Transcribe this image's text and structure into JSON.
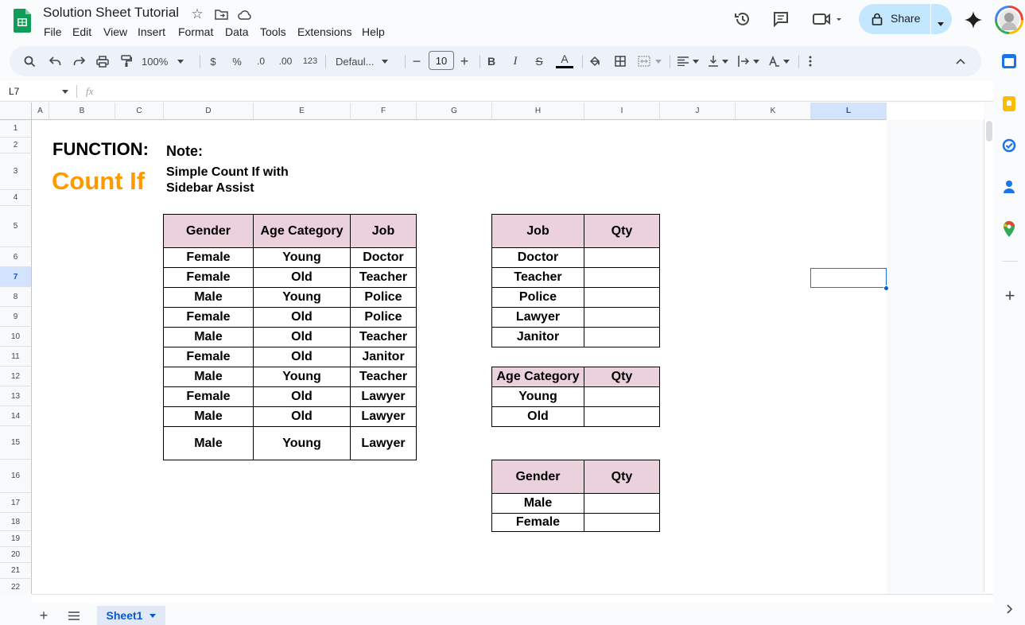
{
  "app": {
    "title": "Solution Sheet Tutorial",
    "menu": [
      "File",
      "Edit",
      "View",
      "Insert",
      "Format",
      "Data",
      "Tools",
      "Extensions",
      "Help"
    ],
    "share_label": "Share"
  },
  "toolbar": {
    "zoom": "100%",
    "currency": "$",
    "percent": "%",
    "dec_decrease": ".0",
    "dec_increase": ".00",
    "number_format": "123",
    "font": "Defaul...",
    "font_size": "10",
    "bold": "B",
    "italic": "I",
    "strike": "S",
    "text_color": "A"
  },
  "formula_bar": {
    "name_box": "L7",
    "fx": "fx"
  },
  "columns": [
    "A",
    "B",
    "C",
    "D",
    "E",
    "F",
    "G",
    "H",
    "I",
    "J",
    "K",
    "L"
  ],
  "selected_column": "L",
  "selected_row": "7",
  "rows": [
    "1",
    "2",
    "3",
    "4",
    "5",
    "6",
    "7",
    "8",
    "9",
    "10",
    "11",
    "12",
    "13",
    "14",
    "15",
    "16",
    "17",
    "18",
    "19",
    "20",
    "21",
    "22"
  ],
  "sheet": {
    "function_label": "FUNCTION:",
    "function_name": "Count If",
    "note_label": "Note:",
    "note_line1": "Simple Count If with",
    "note_line2": "Sidebar Assist"
  },
  "main_table": {
    "headers": [
      "Gender",
      "Age Category",
      "Job"
    ],
    "rows": [
      [
        "Female",
        "Young",
        "Doctor"
      ],
      [
        "Female",
        "Old",
        "Teacher"
      ],
      [
        "Male",
        "Young",
        "Police"
      ],
      [
        "Female",
        "Old",
        "Police"
      ],
      [
        "Male",
        "Old",
        "Teacher"
      ],
      [
        "Female",
        "Old",
        "Janitor"
      ],
      [
        "Male",
        "Young",
        "Teacher"
      ],
      [
        "Female",
        "Old",
        "Lawyer"
      ],
      [
        "Male",
        "Old",
        "Lawyer"
      ],
      [
        "Male",
        "Young",
        "Lawyer"
      ]
    ]
  },
  "job_table": {
    "headers": [
      "Job",
      "Qty"
    ],
    "rows": [
      [
        "Doctor",
        ""
      ],
      [
        "Teacher",
        ""
      ],
      [
        "Police",
        ""
      ],
      [
        "Lawyer",
        ""
      ],
      [
        "Janitor",
        ""
      ]
    ]
  },
  "age_table": {
    "headers": [
      "Age Category",
      "Qty"
    ],
    "rows": [
      [
        "Young",
        ""
      ],
      [
        "Old",
        ""
      ]
    ]
  },
  "gender_table": {
    "headers": [
      "Gender",
      "Qty"
    ],
    "rows": [
      [
        "Male",
        ""
      ],
      [
        "Female",
        ""
      ]
    ]
  },
  "tabs": {
    "active": "Sheet1"
  },
  "colors": {
    "accent": "#0b57d0",
    "header_fill": "#ead1dc",
    "count_if_orange": "#ff9900",
    "share_bg": "#c2e7ff"
  }
}
